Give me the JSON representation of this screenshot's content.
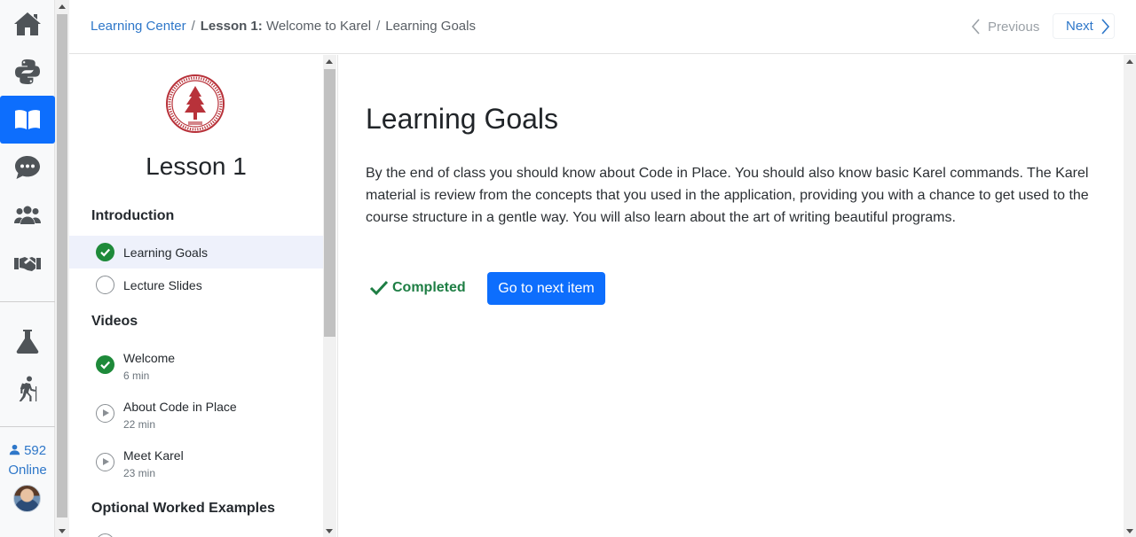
{
  "rail": {
    "items": [
      {
        "icon": "home-icon"
      },
      {
        "icon": "python-icon"
      },
      {
        "icon": "book-open-icon",
        "active": true
      },
      {
        "icon": "chat-bubble-icon"
      },
      {
        "icon": "users-icon"
      },
      {
        "icon": "handshake-icon"
      },
      {
        "icon": "flask-icon"
      },
      {
        "icon": "hiking-icon"
      }
    ],
    "online_count": "592",
    "online_label": "Online"
  },
  "breadcrumb": {
    "root": "Learning Center",
    "separator": "/",
    "lesson_prefix": "Lesson 1:",
    "lesson_name": "Welcome to Karel",
    "current": "Learning Goals"
  },
  "pager": {
    "previous": "Previous",
    "next": "Next"
  },
  "sidebar": {
    "lesson_title": "Lesson 1",
    "sections": [
      {
        "title": "Introduction",
        "items": [
          {
            "label": "Learning Goals",
            "status": "done",
            "active": true
          },
          {
            "label": "Lecture Slides",
            "status": "todo"
          }
        ]
      },
      {
        "title": "Videos",
        "items": [
          {
            "label": "Welcome",
            "duration": "6 min",
            "status": "done"
          },
          {
            "label": "About Code in Place",
            "duration": "22 min",
            "status": "video"
          },
          {
            "label": "Meet Karel",
            "duration": "23 min",
            "status": "video"
          }
        ]
      },
      {
        "title": "Optional Worked Examples",
        "items": []
      }
    ]
  },
  "main": {
    "title": "Learning Goals",
    "body": "By the end of class you should know about Code in Place. You should also know basic Karel commands. The Karel material is review from the concepts that you used in the application, providing you with a chance to get used to the course structure in a gentle way. You will also learn about the art of writing beautiful programs.",
    "completed_label": "Completed",
    "next_button": "Go to next item"
  },
  "colors": {
    "accent": "#0d6efd",
    "link": "#2e77c9",
    "success": "#1e7e44",
    "done_icon": "#1e8a3a"
  }
}
